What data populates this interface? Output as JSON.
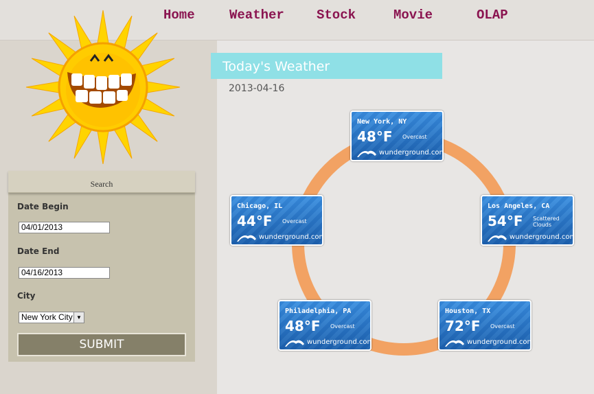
{
  "nav": {
    "items": [
      {
        "label": "Home"
      },
      {
        "label": "Weather"
      },
      {
        "label": "Stock"
      },
      {
        "label": "Movie"
      },
      {
        "label": "OLAP"
      }
    ]
  },
  "search": {
    "header": "Search",
    "date_begin_label": "Date Begin",
    "date_begin_value": "04/01/2013",
    "date_end_label": "Date End",
    "date_end_value": "04/16/2013",
    "city_label": "City",
    "city_value": "New York City",
    "submit_label": "SUBMIT"
  },
  "main": {
    "title": "Today's Weather",
    "date": "2013-04-16"
  },
  "weather_cards": [
    {
      "city": "New York, NY",
      "temp": "48°F",
      "condition": "Overcast",
      "brand": "wunderground.com®"
    },
    {
      "city": "Los Angeles, CA",
      "temp": "54°F",
      "condition": "Scattered Clouds",
      "brand": "wunderground.com®"
    },
    {
      "city": "Houston, TX",
      "temp": "72°F",
      "condition": "Overcast",
      "brand": "wunderground.com®"
    },
    {
      "city": "Philadelphia, PA",
      "temp": "48°F",
      "condition": "Overcast",
      "brand": "wunderground.com®"
    },
    {
      "city": "Chicago, IL",
      "temp": "44°F",
      "condition": "Overcast",
      "brand": "wunderground.com®"
    }
  ],
  "colors": {
    "nav_text": "#8a1450",
    "title_bg": "#8fe0e6",
    "ring": "#f2a263",
    "card_blue": "#2a7fd4",
    "submit_bg": "#858069"
  },
  "icons": {
    "logo": "sun-cartoon-icon",
    "select_arrow": "chevron-down-icon",
    "brand_mark": "wunderground-logo-icon"
  }
}
